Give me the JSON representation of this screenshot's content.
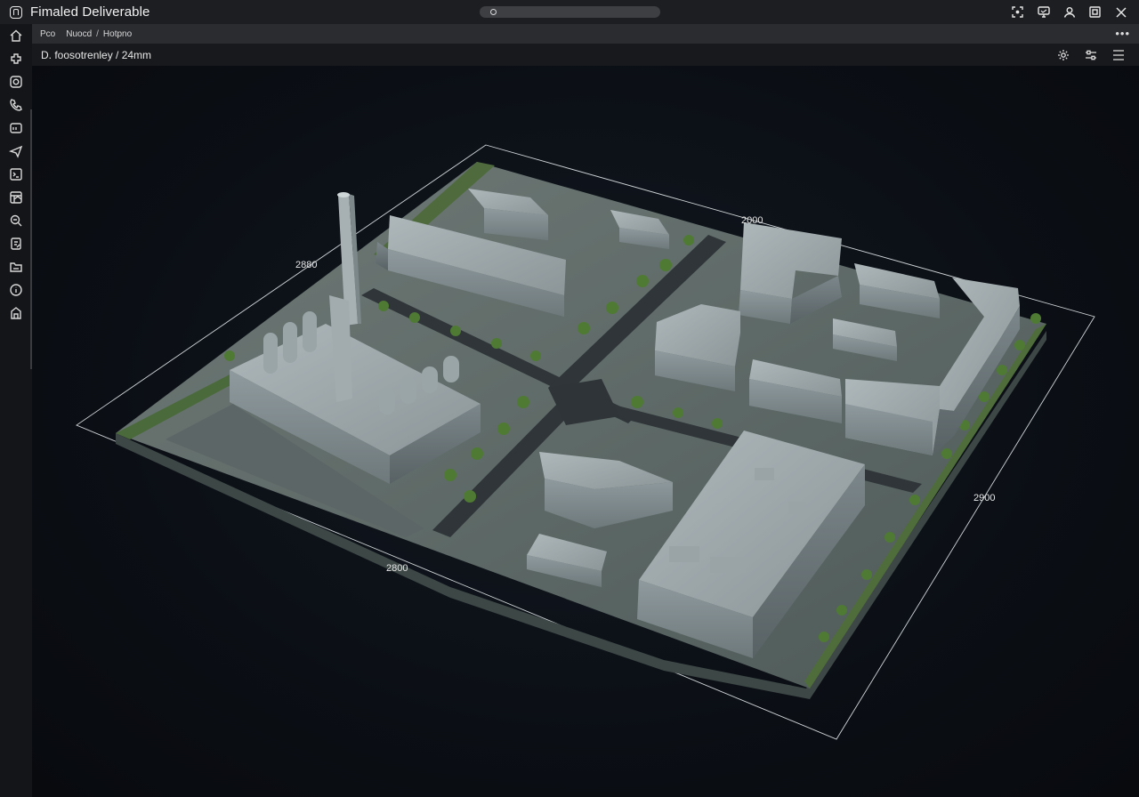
{
  "window": {
    "title": "Fimaled Deliverable"
  },
  "search": {
    "placeholder": "",
    "value": ""
  },
  "breadcrumb": {
    "items": [
      "Pco",
      "Nuocd",
      "Hotpno"
    ]
  },
  "toolbar": {
    "label": "D. foosotrenley / 24mm"
  },
  "viewport": {
    "dimensions": {
      "top_left": "2880",
      "top_right": "2000",
      "right": "2900",
      "bottom": "2800"
    }
  }
}
